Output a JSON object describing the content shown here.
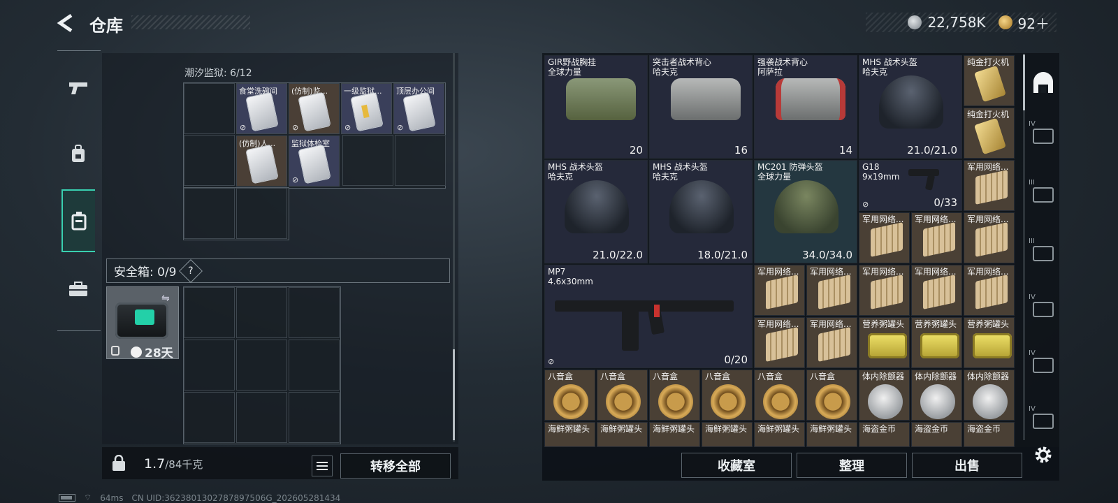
{
  "header": {
    "title": "仓库",
    "currency_coin": "22,758K",
    "currency_gold": "92＋"
  },
  "left_rail": {
    "items": [
      {
        "name": "weapon-tab",
        "icon": "gun-icon"
      },
      {
        "name": "gear-tab",
        "icon": "backpack-icon"
      },
      {
        "name": "container-tab",
        "icon": "case-icon",
        "active": true
      },
      {
        "name": "kit-tab",
        "icon": "briefcase-icon"
      }
    ]
  },
  "inventory": {
    "section_label": "潮汐监狱: 6/12",
    "items": [
      {
        "name": "食堂洗碗间",
        "variant": "card"
      },
      {
        "name": "(仿制)监...",
        "variant": "card"
      },
      {
        "name": "一级监狱...",
        "variant": "card-gold"
      },
      {
        "name": "顶层办公间",
        "variant": "card"
      },
      {
        "name": "(仿制)人...",
        "variant": "card"
      },
      {
        "name": "监狱体检室",
        "variant": "card"
      }
    ],
    "safe_label": "安全箱: 0/9",
    "safe_help": "?",
    "safe_case_time": "28天",
    "weight_value": "1.7",
    "weight_capacity": "/84千克",
    "transfer_all": "转移全部"
  },
  "storage": {
    "row1": [
      {
        "name": "GIR野战胸挂",
        "sub": "全球力量",
        "value": "20",
        "type": "vest-green"
      },
      {
        "name": "突击者战术背心",
        "sub": "哈夫克",
        "value": "16",
        "type": "vest-grey"
      },
      {
        "name": "强袭战术背心",
        "sub": "阿萨拉",
        "value": "14",
        "type": "vest-red"
      },
      {
        "name": "MHS 战术头盔",
        "sub": "哈夫克",
        "value": "21.0/21.0",
        "type": "helmet"
      }
    ],
    "lighter_1": "纯金打火机",
    "lighter_2": "纯金打火机",
    "row2": [
      {
        "name": "MHS 战术头盔",
        "sub": "哈夫克",
        "value": "21.0/22.0",
        "type": "helmet"
      },
      {
        "name": "MHS 战术头盔",
        "sub": "哈夫克",
        "value": "18.0/21.0",
        "type": "helmet"
      },
      {
        "name": "MC201 防弹头盔",
        "sub": "全球力量",
        "value": "34.0/34.0",
        "type": "helmet-camo"
      }
    ],
    "g18": {
      "name": "G18",
      "sub": "9x19mm",
      "value": "0/33"
    },
    "mp7": {
      "name": "MP7",
      "sub": "4.6x30mm",
      "value": "0/20"
    },
    "ammo_label": "军用网络...",
    "can_label": "营养粥罐头",
    "musicbox_label": "八音盒",
    "silencer_label": "体内除颤器",
    "seafood_label": "海鲜粥罐头",
    "pirate_label": "海盗金币",
    "btn_collection": "收藏室",
    "btn_sort": "整理",
    "btn_sell": "出售"
  },
  "status_bar": {
    "ping": "64ms",
    "uid": "CN UID:3623801302787897506G_202605281434"
  }
}
